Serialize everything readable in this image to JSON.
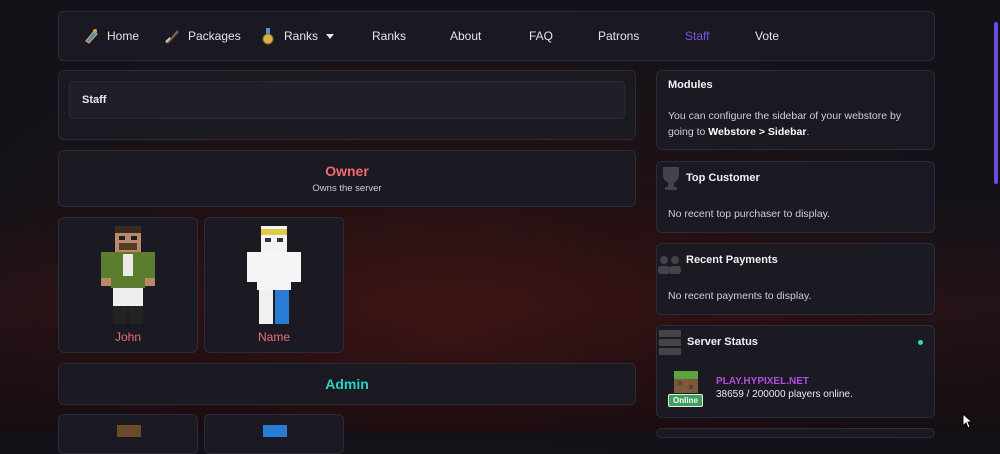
{
  "nav": {
    "items": [
      {
        "label": "Home",
        "icon": "potion-icon"
      },
      {
        "label": "Packages",
        "icon": "sword-icon"
      },
      {
        "label": "Ranks",
        "icon": "medal-icon",
        "dropdown": true
      },
      {
        "label": "Ranks"
      },
      {
        "label": "About"
      },
      {
        "label": "FAQ"
      },
      {
        "label": "Patrons"
      },
      {
        "label": "Staff",
        "active": true
      },
      {
        "label": "Vote"
      }
    ]
  },
  "staff": {
    "title": "Staff"
  },
  "groups": [
    {
      "name": "Owner",
      "description": "Owns the server",
      "color": "#ef6b6b",
      "members": [
        {
          "name": "John"
        },
        {
          "name": "Name"
        }
      ]
    },
    {
      "name": "Admin",
      "color": "#27d3c4"
    }
  ],
  "sidebar": {
    "modules": {
      "title": "Modules",
      "text_before": "You can configure the sidebar of your webstore by going to ",
      "link1": "Webstore",
      "sep": " > ",
      "link2": "Sidebar",
      "text_after": "."
    },
    "top_customer": {
      "title": "Top Customer",
      "text": "No recent top purchaser to display."
    },
    "recent_payments": {
      "title": "Recent Payments",
      "text": "No recent payments to display."
    },
    "server_status": {
      "title": "Server Status",
      "badge": "Online",
      "address": "PLAY.HYPIXEL.NET",
      "players": "38659 / 200000 players online.",
      "status_color": "#2fe0a6",
      "address_color": "#b04ee0"
    }
  }
}
